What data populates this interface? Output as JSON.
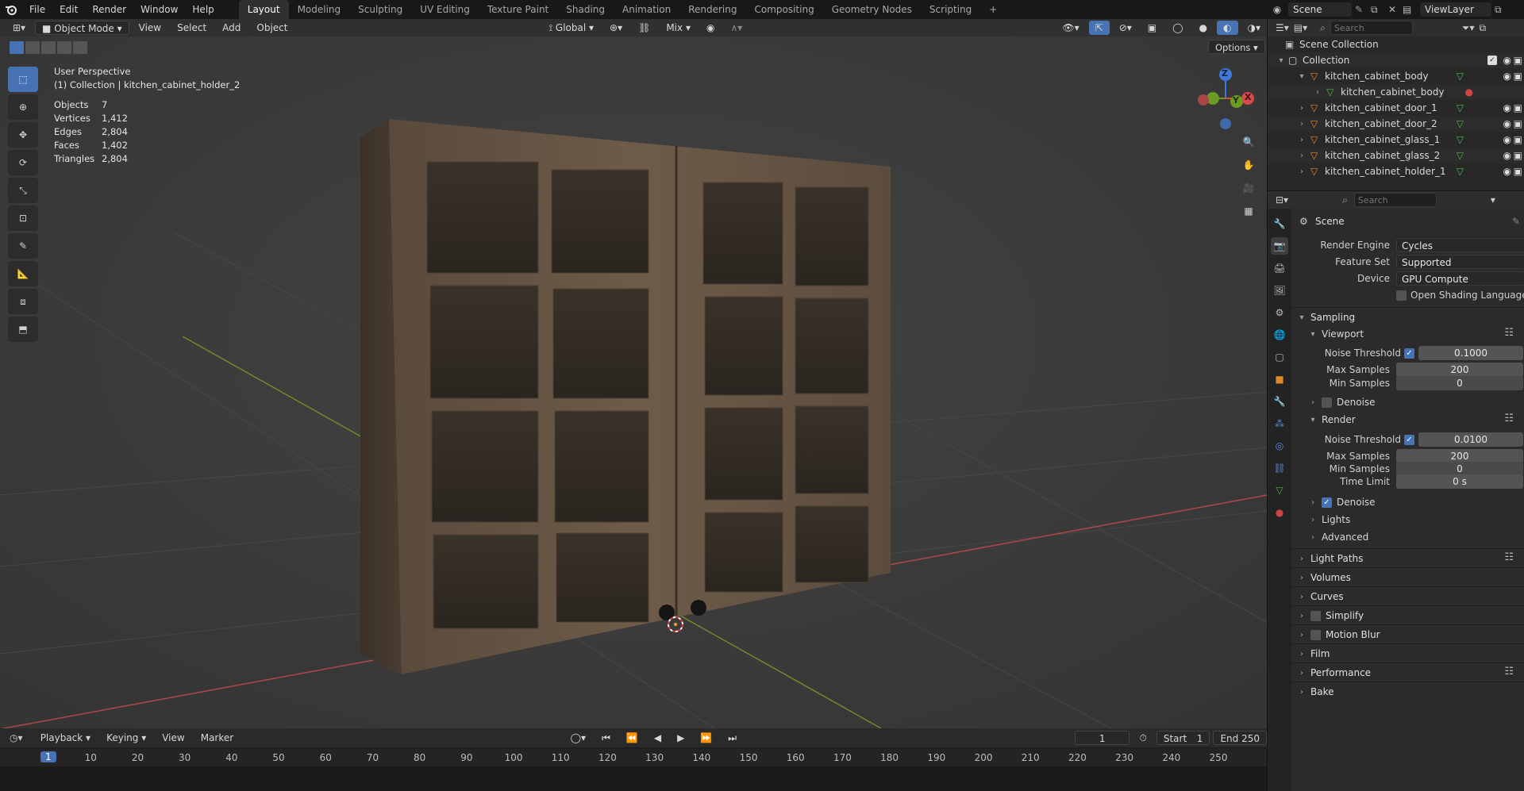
{
  "menu": {
    "file": "File",
    "edit": "Edit",
    "render": "Render",
    "window": "Window",
    "help": "Help"
  },
  "workspaces": [
    "Layout",
    "Modeling",
    "Sculpting",
    "UV Editing",
    "Texture Paint",
    "Shading",
    "Animation",
    "Rendering",
    "Compositing",
    "Geometry Nodes",
    "Scripting"
  ],
  "scenebar": {
    "scene": "Scene",
    "viewlayer": "ViewLayer"
  },
  "vp_header": {
    "mode": "Object Mode",
    "view": "View",
    "select": "Select",
    "add": "Add",
    "object": "Object",
    "orientation": "Global",
    "pivot_mix": "Mix",
    "options": "Options"
  },
  "viewport_info": {
    "perspective": "User Perspective",
    "collection": "(1) Collection | kitchen_cabinet_holder_2"
  },
  "stats": [
    {
      "label": "Objects",
      "value": "7"
    },
    {
      "label": "Vertices",
      "value": "1,412"
    },
    {
      "label": "Edges",
      "value": "2,804"
    },
    {
      "label": "Faces",
      "value": "1,402"
    },
    {
      "label": "Triangles",
      "value": "2,804"
    }
  ],
  "gizmo": {
    "z": "Z",
    "y": "Y",
    "x": "X"
  },
  "timeline": {
    "playback": "Playback",
    "keying": "Keying",
    "view": "View",
    "marker": "Marker",
    "current_frame": "1",
    "start_label": "Start",
    "start": "1",
    "end_label": "End",
    "end": "250",
    "ticks": [
      "1",
      "10",
      "20",
      "30",
      "40",
      "50",
      "60",
      "70",
      "80",
      "90",
      "100",
      "110",
      "120",
      "130",
      "140",
      "150",
      "160",
      "170",
      "180",
      "190",
      "200",
      "210",
      "220",
      "230",
      "240",
      "250"
    ]
  },
  "outliner": {
    "search_placeholder": "Search",
    "scene_collection": "Scene Collection",
    "collection": "Collection",
    "items": [
      {
        "name": "kitchen_cabinet_body",
        "level": 1,
        "expanded": true
      },
      {
        "name": "kitchen_cabinet_body",
        "level": 2,
        "mesh": true
      },
      {
        "name": "kitchen_cabinet_door_1",
        "level": 1
      },
      {
        "name": "kitchen_cabinet_door_2",
        "level": 1
      },
      {
        "name": "kitchen_cabinet_glass_1",
        "level": 1
      },
      {
        "name": "kitchen_cabinet_glass_2",
        "level": 1
      },
      {
        "name": "kitchen_cabinet_holder_1",
        "level": 1
      }
    ]
  },
  "properties": {
    "search_placeholder": "Search",
    "context": "Scene",
    "render_engine_label": "Render Engine",
    "render_engine": "Cycles",
    "feature_set_label": "Feature Set",
    "feature_set": "Supported",
    "device_label": "Device",
    "device": "GPU Compute",
    "osl_label": "Open Shading Language",
    "sampling": "Sampling",
    "viewport": "Viewport",
    "noise_threshold_label": "Noise Threshold",
    "vp_noise": "0.1000",
    "max_samples_label": "Max Samples",
    "vp_max": "200",
    "min_samples_label": "Min Samples",
    "vp_min": "0",
    "denoise": "Denoise",
    "render": "Render",
    "r_noise": "0.0100",
    "r_max": "200",
    "r_min": "0",
    "time_limit_label": "Time Limit",
    "r_time": "0 s",
    "lights": "Lights",
    "advanced": "Advanced",
    "light_paths": "Light Paths",
    "volumes": "Volumes",
    "curves": "Curves",
    "simplify": "Simplify",
    "motion_blur": "Motion Blur",
    "film": "Film",
    "performance": "Performance",
    "bake": "Bake"
  }
}
